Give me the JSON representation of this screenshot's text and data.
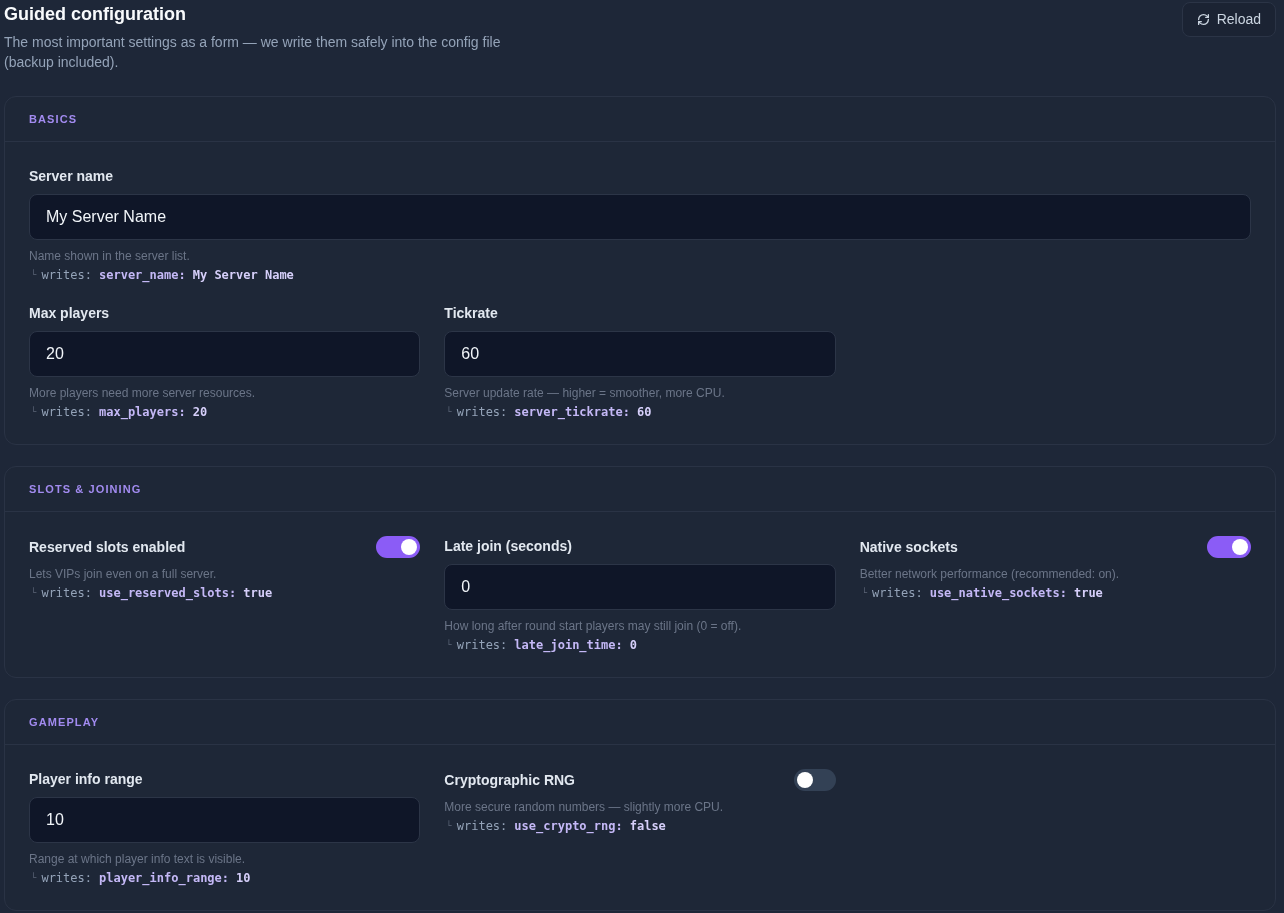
{
  "header": {
    "title": "Guided configuration",
    "description": "The most important settings as a form — we write them safely into the config file (backup included).",
    "reload_button": "Reload"
  },
  "sections": [
    {
      "title": "BASICS",
      "fields": [
        {
          "kind": "text",
          "label": "Server name",
          "value": "My Server Name",
          "hint": "Name shown in the server list.",
          "writes": {
            "branch": "└",
            "prefix": "writes:",
            "key": "server_name:",
            "value": "My Server Name"
          }
        },
        {
          "kind": "number",
          "label": "Max players",
          "value": "20",
          "hint": "More players need more server resources.",
          "writes": {
            "branch": "└",
            "prefix": "writes:",
            "key": "max_players:",
            "value": "20"
          }
        },
        {
          "kind": "number",
          "label": "Tickrate",
          "value": "60",
          "hint": "Server update rate — higher = smoother, more CPU.",
          "writes": {
            "branch": "└",
            "prefix": "writes:",
            "key": "server_tickrate:",
            "value": "60"
          }
        }
      ]
    },
    {
      "title": "SLOTS & JOINING",
      "fields": [
        {
          "kind": "toggle",
          "label": "Reserved slots enabled",
          "on": true,
          "hint": "Lets VIPs join even on a full server.",
          "writes": {
            "branch": "└",
            "prefix": "writes:",
            "key": "use_reserved_slots:",
            "value": "true"
          }
        },
        {
          "kind": "number",
          "label": "Late join (seconds)",
          "value": "0",
          "hint": "How long after round start players may still join (0 = off).",
          "writes": {
            "branch": "└",
            "prefix": "writes:",
            "key": "late_join_time:",
            "value": "0"
          }
        },
        {
          "kind": "toggle",
          "label": "Native sockets",
          "on": true,
          "hint": "Better network performance (recommended: on).",
          "writes": {
            "branch": "└",
            "prefix": "writes:",
            "key": "use_native_sockets:",
            "value": "true"
          }
        }
      ]
    },
    {
      "title": "GAMEPLAY",
      "fields": [
        {
          "kind": "number",
          "label": "Player info range",
          "value": "10",
          "hint": "Range at which player info text is visible.",
          "writes": {
            "branch": "└",
            "prefix": "writes:",
            "key": "player_info_range:",
            "value": "10"
          }
        },
        {
          "kind": "toggle",
          "label": "Cryptographic RNG",
          "on": false,
          "hint": "More secure random numbers — slightly more CPU.",
          "writes": {
            "branch": "└",
            "prefix": "writes:",
            "key": "use_crypto_rng:",
            "value": "false"
          }
        }
      ]
    }
  ]
}
